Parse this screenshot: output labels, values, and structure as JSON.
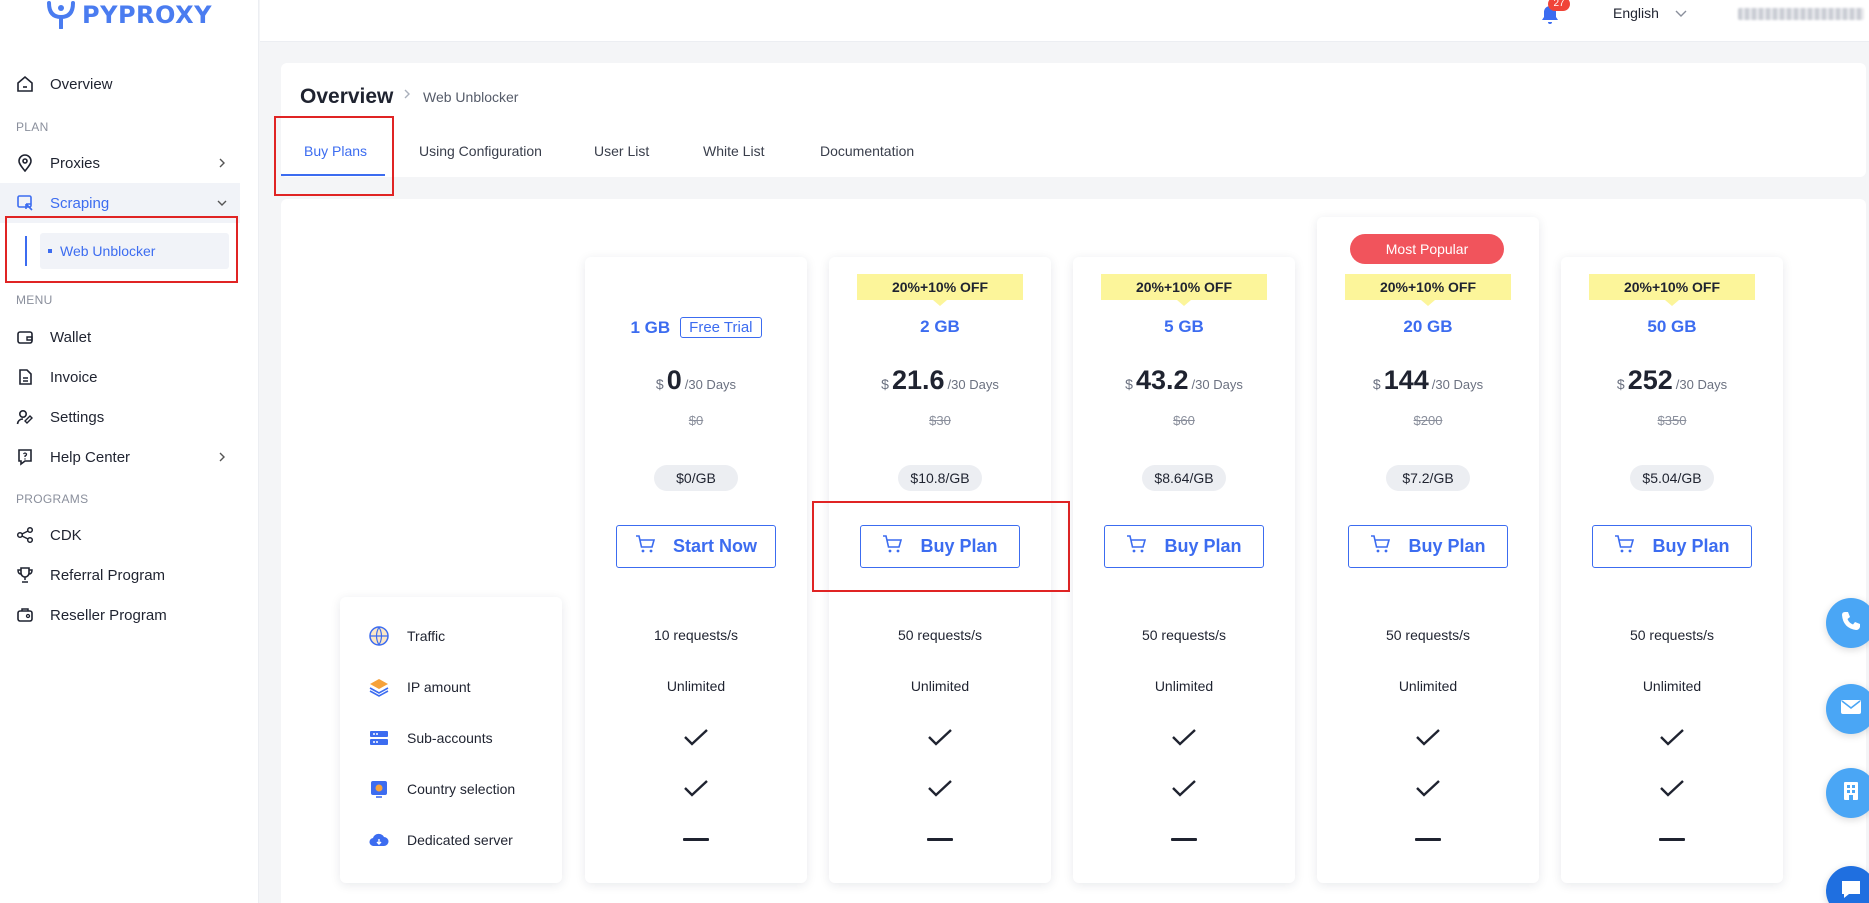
{
  "brand": {
    "name": "PYPROXY"
  },
  "sidebar": {
    "overview": "Overview",
    "section_plan": "PLAN",
    "proxies": "Proxies",
    "scraping": "Scraping",
    "web_unblocker": "Web Unblocker",
    "section_menu": "MENU",
    "wallet": "Wallet",
    "invoice": "Invoice",
    "settings": "Settings",
    "help_center": "Help Center",
    "section_programs": "PROGRAMS",
    "cdk": "CDK",
    "referral": "Referral Program",
    "reseller": "Reseller Program"
  },
  "topbar": {
    "notification_count": "27",
    "language": "English"
  },
  "breadcrumb": {
    "title": "Overview",
    "current": "Web Unblocker"
  },
  "tabs": [
    {
      "label": "Buy Plans",
      "active": true
    },
    {
      "label": "Using Configuration"
    },
    {
      "label": "User List"
    },
    {
      "label": "White List"
    },
    {
      "label": "Documentation"
    }
  ],
  "features": [
    "Traffic",
    "IP amount",
    "Sub-accounts",
    "Country selection",
    "Dedicated server"
  ],
  "plans": [
    {
      "size": "1 GB",
      "tag": "Free Trial",
      "currency": "$",
      "price": "0",
      "period": "/30 Days",
      "original": "$0",
      "per_gb": "$0/GB",
      "button": "Start Now",
      "traffic": "10 requests/s",
      "ip_amount": "Unlimited",
      "sub_accounts": true,
      "country_selection": true,
      "dedicated_server": false
    },
    {
      "size": "2 GB",
      "discount": "20%+10% OFF",
      "currency": "$",
      "price": "21.6",
      "period": "/30 Days",
      "original": "$30",
      "per_gb": "$10.8/GB",
      "button": "Buy Plan",
      "traffic": "50 requests/s",
      "ip_amount": "Unlimited",
      "sub_accounts": true,
      "country_selection": true,
      "dedicated_server": false
    },
    {
      "size": "5 GB",
      "discount": "20%+10% OFF",
      "currency": "$",
      "price": "43.2",
      "period": "/30 Days",
      "original": "$60",
      "per_gb": "$8.64/GB",
      "button": "Buy Plan",
      "traffic": "50 requests/s",
      "ip_amount": "Unlimited",
      "sub_accounts": true,
      "country_selection": true,
      "dedicated_server": false
    },
    {
      "size": "20 GB",
      "badge": "Most Popular",
      "discount": "20%+10% OFF",
      "currency": "$",
      "price": "144",
      "period": "/30 Days",
      "original": "$200",
      "per_gb": "$7.2/GB",
      "button": "Buy Plan",
      "traffic": "50 requests/s",
      "ip_amount": "Unlimited",
      "sub_accounts": true,
      "country_selection": true,
      "dedicated_server": false
    },
    {
      "size": "50 GB",
      "discount": "20%+10% OFF",
      "currency": "$",
      "price": "252",
      "period": "/30 Days",
      "original": "$350",
      "per_gb": "$5.04/GB",
      "button": "Buy Plan",
      "traffic": "50 requests/s",
      "ip_amount": "Unlimited",
      "sub_accounts": true,
      "country_selection": true,
      "dedicated_server": false
    }
  ],
  "colors": {
    "accent": "#3c6cf0",
    "discount_bg": "#fcf59a",
    "popular": "#f1545c",
    "highlight_box": "#e02424"
  }
}
